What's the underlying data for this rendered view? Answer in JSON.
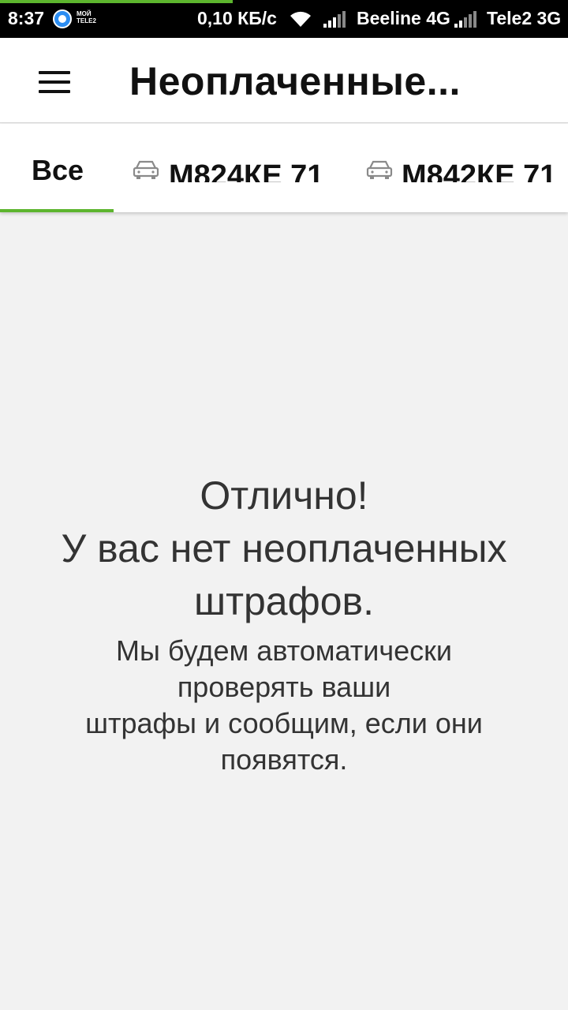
{
  "status_bar": {
    "time": "8:37",
    "app_badge": "МОЙ TELE2",
    "net_speed": "0,10 КБ/с",
    "carrier1": "Beeline 4G",
    "carrier2": "Tele2 3G"
  },
  "app_bar": {
    "title": "Неоплаченные..."
  },
  "tabs": [
    {
      "label": "Все"
    },
    {
      "label": "М824КЕ 71"
    },
    {
      "label": "М842КЕ 71"
    }
  ],
  "empty_state": {
    "line1": "Отлично!",
    "line2": "У вас нет неоплаченных",
    "line3": "штрафов.",
    "sub1": "Мы будем автоматически",
    "sub2": "проверять ваши",
    "sub3": "штрафы и сообщим, если они",
    "sub4": "появятся."
  },
  "colors": {
    "accent": "#5db52e",
    "status_bar": "#000000",
    "background": "#f2f2f2"
  }
}
